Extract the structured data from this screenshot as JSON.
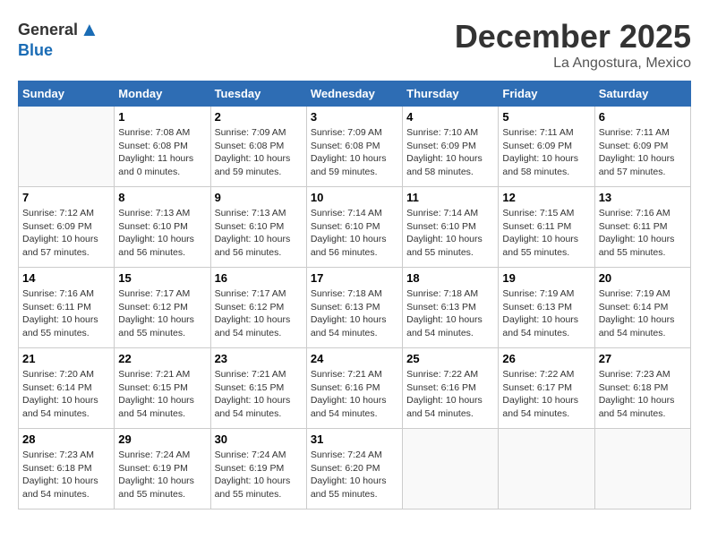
{
  "header": {
    "logo_general": "General",
    "logo_blue": "Blue",
    "month": "December 2025",
    "location": "La Angostura, Mexico"
  },
  "days_of_week": [
    "Sunday",
    "Monday",
    "Tuesday",
    "Wednesday",
    "Thursday",
    "Friday",
    "Saturday"
  ],
  "weeks": [
    [
      {
        "day": "",
        "info": ""
      },
      {
        "day": "1",
        "info": "Sunrise: 7:08 AM\nSunset: 6:08 PM\nDaylight: 11 hours\nand 0 minutes."
      },
      {
        "day": "2",
        "info": "Sunrise: 7:09 AM\nSunset: 6:08 PM\nDaylight: 10 hours\nand 59 minutes."
      },
      {
        "day": "3",
        "info": "Sunrise: 7:09 AM\nSunset: 6:08 PM\nDaylight: 10 hours\nand 59 minutes."
      },
      {
        "day": "4",
        "info": "Sunrise: 7:10 AM\nSunset: 6:09 PM\nDaylight: 10 hours\nand 58 minutes."
      },
      {
        "day": "5",
        "info": "Sunrise: 7:11 AM\nSunset: 6:09 PM\nDaylight: 10 hours\nand 58 minutes."
      },
      {
        "day": "6",
        "info": "Sunrise: 7:11 AM\nSunset: 6:09 PM\nDaylight: 10 hours\nand 57 minutes."
      }
    ],
    [
      {
        "day": "7",
        "info": "Sunrise: 7:12 AM\nSunset: 6:09 PM\nDaylight: 10 hours\nand 57 minutes."
      },
      {
        "day": "8",
        "info": "Sunrise: 7:13 AM\nSunset: 6:10 PM\nDaylight: 10 hours\nand 56 minutes."
      },
      {
        "day": "9",
        "info": "Sunrise: 7:13 AM\nSunset: 6:10 PM\nDaylight: 10 hours\nand 56 minutes."
      },
      {
        "day": "10",
        "info": "Sunrise: 7:14 AM\nSunset: 6:10 PM\nDaylight: 10 hours\nand 56 minutes."
      },
      {
        "day": "11",
        "info": "Sunrise: 7:14 AM\nSunset: 6:10 PM\nDaylight: 10 hours\nand 55 minutes."
      },
      {
        "day": "12",
        "info": "Sunrise: 7:15 AM\nSunset: 6:11 PM\nDaylight: 10 hours\nand 55 minutes."
      },
      {
        "day": "13",
        "info": "Sunrise: 7:16 AM\nSunset: 6:11 PM\nDaylight: 10 hours\nand 55 minutes."
      }
    ],
    [
      {
        "day": "14",
        "info": "Sunrise: 7:16 AM\nSunset: 6:11 PM\nDaylight: 10 hours\nand 55 minutes."
      },
      {
        "day": "15",
        "info": "Sunrise: 7:17 AM\nSunset: 6:12 PM\nDaylight: 10 hours\nand 55 minutes."
      },
      {
        "day": "16",
        "info": "Sunrise: 7:17 AM\nSunset: 6:12 PM\nDaylight: 10 hours\nand 54 minutes."
      },
      {
        "day": "17",
        "info": "Sunrise: 7:18 AM\nSunset: 6:13 PM\nDaylight: 10 hours\nand 54 minutes."
      },
      {
        "day": "18",
        "info": "Sunrise: 7:18 AM\nSunset: 6:13 PM\nDaylight: 10 hours\nand 54 minutes."
      },
      {
        "day": "19",
        "info": "Sunrise: 7:19 AM\nSunset: 6:13 PM\nDaylight: 10 hours\nand 54 minutes."
      },
      {
        "day": "20",
        "info": "Sunrise: 7:19 AM\nSunset: 6:14 PM\nDaylight: 10 hours\nand 54 minutes."
      }
    ],
    [
      {
        "day": "21",
        "info": "Sunrise: 7:20 AM\nSunset: 6:14 PM\nDaylight: 10 hours\nand 54 minutes."
      },
      {
        "day": "22",
        "info": "Sunrise: 7:21 AM\nSunset: 6:15 PM\nDaylight: 10 hours\nand 54 minutes."
      },
      {
        "day": "23",
        "info": "Sunrise: 7:21 AM\nSunset: 6:15 PM\nDaylight: 10 hours\nand 54 minutes."
      },
      {
        "day": "24",
        "info": "Sunrise: 7:21 AM\nSunset: 6:16 PM\nDaylight: 10 hours\nand 54 minutes."
      },
      {
        "day": "25",
        "info": "Sunrise: 7:22 AM\nSunset: 6:16 PM\nDaylight: 10 hours\nand 54 minutes."
      },
      {
        "day": "26",
        "info": "Sunrise: 7:22 AM\nSunset: 6:17 PM\nDaylight: 10 hours\nand 54 minutes."
      },
      {
        "day": "27",
        "info": "Sunrise: 7:23 AM\nSunset: 6:18 PM\nDaylight: 10 hours\nand 54 minutes."
      }
    ],
    [
      {
        "day": "28",
        "info": "Sunrise: 7:23 AM\nSunset: 6:18 PM\nDaylight: 10 hours\nand 54 minutes."
      },
      {
        "day": "29",
        "info": "Sunrise: 7:24 AM\nSunset: 6:19 PM\nDaylight: 10 hours\nand 55 minutes."
      },
      {
        "day": "30",
        "info": "Sunrise: 7:24 AM\nSunset: 6:19 PM\nDaylight: 10 hours\nand 55 minutes."
      },
      {
        "day": "31",
        "info": "Sunrise: 7:24 AM\nSunset: 6:20 PM\nDaylight: 10 hours\nand 55 minutes."
      },
      {
        "day": "",
        "info": ""
      },
      {
        "day": "",
        "info": ""
      },
      {
        "day": "",
        "info": ""
      }
    ]
  ]
}
